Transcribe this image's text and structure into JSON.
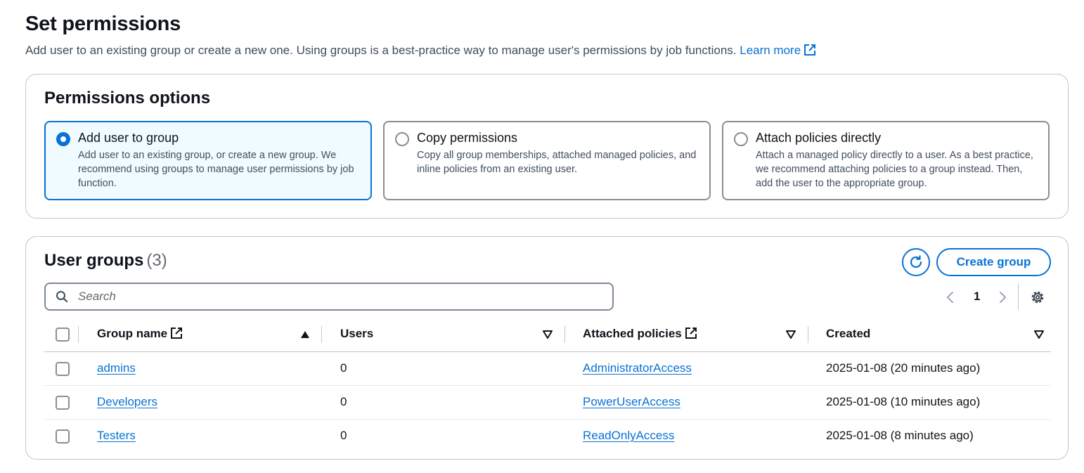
{
  "header": {
    "title": "Set permissions",
    "description": "Add user to an existing group or create a new one. Using groups is a best-practice way to manage user's permissions by job functions.",
    "learn_more": "Learn more"
  },
  "permissions_options": {
    "title": "Permissions options",
    "options": [
      {
        "label": "Add user to group",
        "description": "Add user to an existing group, or create a new group. We recommend using groups to manage user permissions by job function.",
        "selected": true
      },
      {
        "label": "Copy permissions",
        "description": "Copy all group memberships, attached managed policies, and inline policies from an existing user.",
        "selected": false
      },
      {
        "label": "Attach policies directly",
        "description": "Attach a managed policy directly to a user. As a best practice, we recommend attaching policies to a group instead. Then, add the user to the appropriate group.",
        "selected": false
      }
    ]
  },
  "user_groups": {
    "title": "User groups",
    "count": "(3)",
    "create_label": "Create group",
    "search_placeholder": "Search",
    "page": "1",
    "columns": {
      "name": "Group name",
      "users": "Users",
      "policies": "Attached policies",
      "created": "Created"
    },
    "rows": [
      {
        "name": "admins",
        "users": "0",
        "policy": "AdministratorAccess",
        "created": "2025-01-08 (20 minutes ago)"
      },
      {
        "name": "Developers",
        "users": "0",
        "policy": "PowerUserAccess",
        "created": "2025-01-08 (10 minutes ago)"
      },
      {
        "name": "Testers",
        "users": "0",
        "policy": "ReadOnlyAccess",
        "created": "2025-01-08 (8 minutes ago)"
      }
    ]
  },
  "colors": {
    "accent": "#0972d3",
    "selected_bg": "#f0fbff",
    "border": "#c6c6cd",
    "text": "#0f141a",
    "muted": "#414d5c"
  },
  "icons": [
    "external-link-icon",
    "refresh-icon",
    "search-icon",
    "chevron-left-icon",
    "chevron-right-icon",
    "settings-icon",
    "sort-ascending-icon",
    "sort-descending-icon"
  ]
}
